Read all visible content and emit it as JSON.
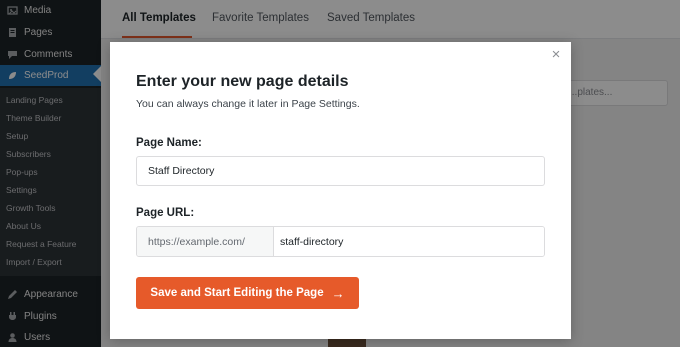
{
  "sidebar": {
    "top_items": [
      {
        "label": "Media",
        "icon": "media-icon"
      },
      {
        "label": "Pages",
        "icon": "pages-icon"
      },
      {
        "label": "Comments",
        "icon": "comments-icon"
      }
    ],
    "active_item": {
      "label": "SeedProd",
      "icon": "seedprod-icon"
    },
    "submenu": [
      "Landing Pages",
      "Theme Builder",
      "Setup",
      "Subscribers",
      "Pop-ups",
      "Settings",
      "Growth Tools",
      "About Us",
      "Request a Feature",
      "Import / Export"
    ],
    "bottom_items": [
      {
        "label": "Appearance",
        "icon": "appearance-icon"
      },
      {
        "label": "Plugins",
        "icon": "plugins-icon"
      },
      {
        "label": "Users",
        "icon": "users-icon"
      }
    ]
  },
  "tabs": [
    "All Templates",
    "Favorite Templates",
    "Saved Templates"
  ],
  "background": {
    "search_placeholder": "...plates..."
  },
  "modal": {
    "title": "Enter your new page details",
    "subtitle": "You can always change it later in Page Settings.",
    "page_name_label": "Page Name:",
    "page_name_value": "Staff Directory",
    "page_url_label": "Page URL:",
    "url_prefix": "https://example.com/",
    "url_slug": "staff-directory",
    "submit_label": "Save and Start Editing the Page",
    "submit_arrow": "→",
    "close_symbol": "×"
  },
  "colors": {
    "accent": "#e65a2a",
    "sidebar_bg": "#1d2327",
    "sidebar_active": "#2271b1"
  }
}
